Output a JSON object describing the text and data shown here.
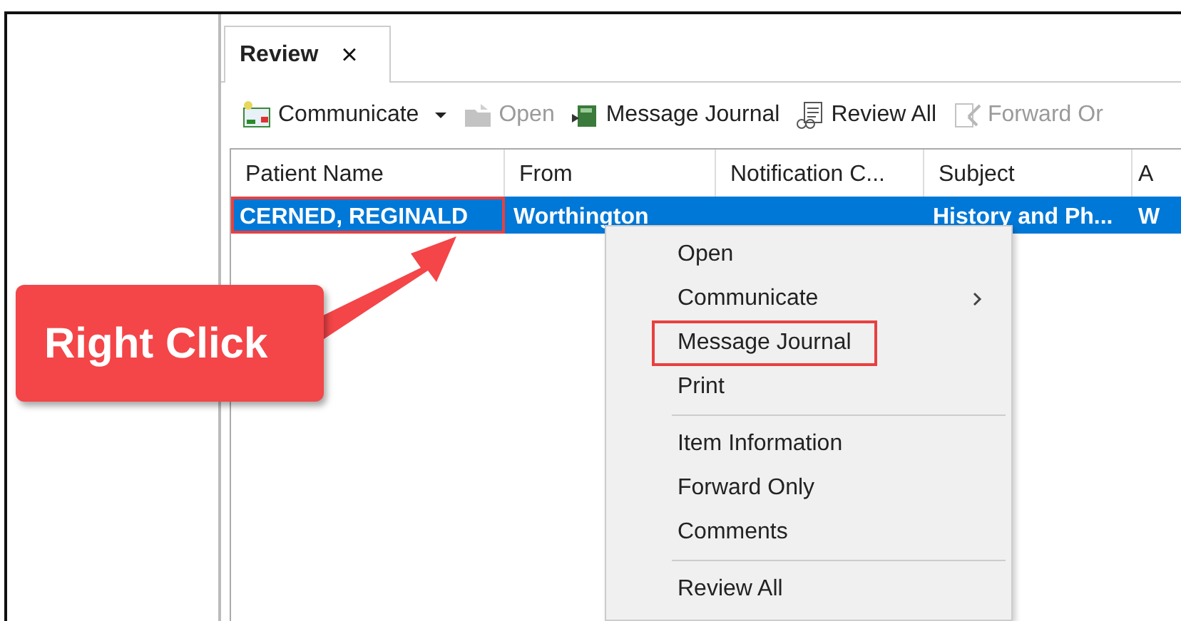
{
  "tab": {
    "label": "Review",
    "close": "×",
    "selected": true
  },
  "toolbar": [
    {
      "label": "Communicate",
      "disabled": false,
      "dropdown": true
    },
    {
      "label": "Open",
      "disabled": true,
      "dropdown": false
    },
    {
      "label": "Message Journal",
      "disabled": false,
      "dropdown": false
    },
    {
      "label": "Review All",
      "disabled": false,
      "dropdown": false
    },
    {
      "label": "Forward Or",
      "disabled": true,
      "dropdown": false
    }
  ],
  "table": {
    "columns": [
      "Patient Name",
      "From",
      "Notification C...",
      "Subject",
      "A"
    ],
    "rows": [
      {
        "selected": true,
        "cells": [
          {
            "text": "CERNED, REGINALD",
            "highlighted": true
          },
          {
            "text": "Worthington",
            "highlighted": false
          },
          null,
          {
            "text": "History and Ph...",
            "highlighted": false
          },
          {
            "text": "W",
            "highlighted": false
          }
        ]
      }
    ]
  },
  "context_menu": {
    "groups": [
      [
        {
          "label": "Open",
          "submenu": false,
          "highlighted": false
        },
        {
          "label": "Communicate",
          "submenu": true,
          "highlighted": false
        },
        {
          "label": "Message Journal",
          "submenu": false,
          "highlighted": true
        },
        {
          "label": "Print",
          "submenu": false,
          "highlighted": false
        }
      ],
      [
        {
          "label": "Item Information",
          "submenu": false,
          "highlighted": false
        },
        {
          "label": "Forward Only",
          "submenu": false,
          "highlighted": false
        },
        {
          "label": "Comments",
          "submenu": false,
          "highlighted": false
        }
      ],
      [
        {
          "label": "Review All",
          "submenu": false,
          "highlighted": false
        }
      ]
    ]
  },
  "callout": {
    "text": "Right Click"
  }
}
